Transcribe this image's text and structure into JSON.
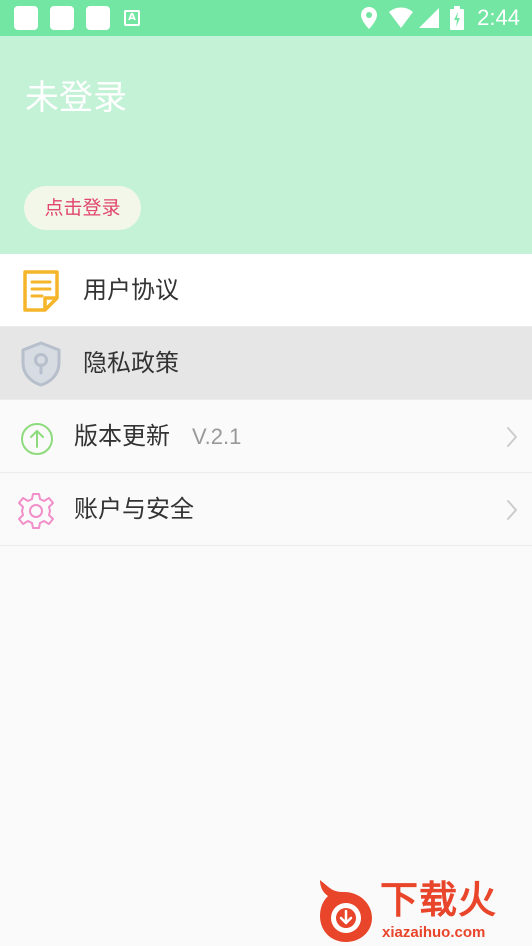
{
  "status_bar": {
    "time": "2:44",
    "left_indicator_letter": "A",
    "icons": [
      "notification-icon",
      "notification-icon",
      "notification-icon",
      "a-icon",
      "location-icon",
      "wifi-icon",
      "signal-icon",
      "battery-icon"
    ]
  },
  "header": {
    "title": "未登录",
    "login_button": "点击登录"
  },
  "menu": {
    "items": [
      {
        "label": "用户协议",
        "icon": "document-icon"
      },
      {
        "label": "隐私政策",
        "icon": "shield-lock-icon"
      },
      {
        "label": "版本更新",
        "icon": "upload-arrow-icon",
        "value": "V.2.1"
      },
      {
        "label": "账户与安全",
        "icon": "gear-icon"
      }
    ]
  },
  "watermark": {
    "text": "下载火",
    "domain": "xiazaihuo.com"
  },
  "colors": {
    "status_bar": "#72e6a2",
    "header_bg": "#c3f2d6",
    "login_text": "#e0466e",
    "selected_row": "#e6e6e6",
    "doc_icon": "#f5b52a",
    "update_icon": "#8edb7d",
    "gear_icon": "#f08fc9",
    "watermark": "#e8452a"
  }
}
